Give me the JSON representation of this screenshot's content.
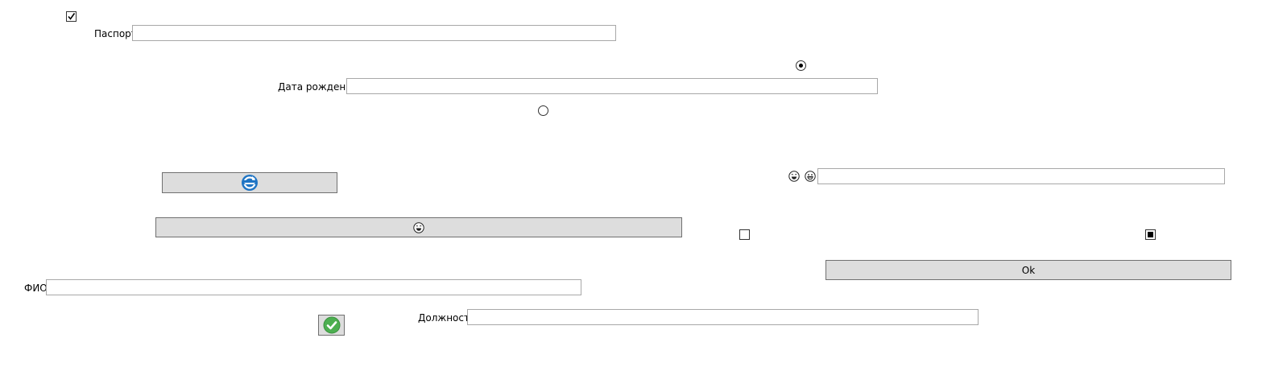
{
  "form": {
    "passport_label": "Паспорт",
    "passport_value": "",
    "birth_date_label": "Дата рождения",
    "birth_date_value": "",
    "fio_label": "ФИО",
    "fio_value": "",
    "position_label": "Должность",
    "position_value": "",
    "emoji_field_value": ""
  },
  "buttons": {
    "ok_label": "Ok",
    "refresh_icon": "refresh-icon",
    "emoji_icon": "laughing-face-icon",
    "confirm_icon": "check-icon"
  },
  "controls": {
    "top_checkbox_checked": true,
    "radio_top_selected": true,
    "radio_bottom_selected": false,
    "middle_checkbox_checked": false,
    "right_checkbox_state": "indeterminate"
  },
  "colors": {
    "button_bg": "#dddddd",
    "button_border": "#707070",
    "textbox_border": "#a8a8a8",
    "refresh_blue": "#1e74c4",
    "check_green": "#4caf50"
  }
}
